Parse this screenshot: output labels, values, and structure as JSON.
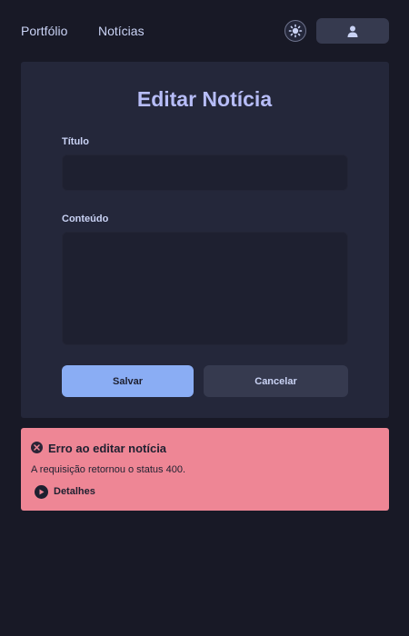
{
  "nav": {
    "links": [
      "Portfólio",
      "Notícias"
    ],
    "theme_icon": "sun-icon",
    "user_icon": "user-icon"
  },
  "form": {
    "title": "Editar Notícia",
    "fields": {
      "title": {
        "label": "Título",
        "value": ""
      },
      "content": {
        "label": "Conteúdo",
        "value": ""
      }
    },
    "save_label": "Salvar",
    "cancel_label": "Cancelar"
  },
  "alert": {
    "icon": "close-circle-icon",
    "title": "Erro ao editar notícia",
    "message": "A requisição retornou o status 400.",
    "details_label": "Detalhes",
    "details_icon": "play-circle-icon"
  },
  "colors": {
    "background": "#181926",
    "card": "#24273a",
    "accent": "#8aadf4",
    "title": "#b7bdf8",
    "error": "#ee8695"
  }
}
